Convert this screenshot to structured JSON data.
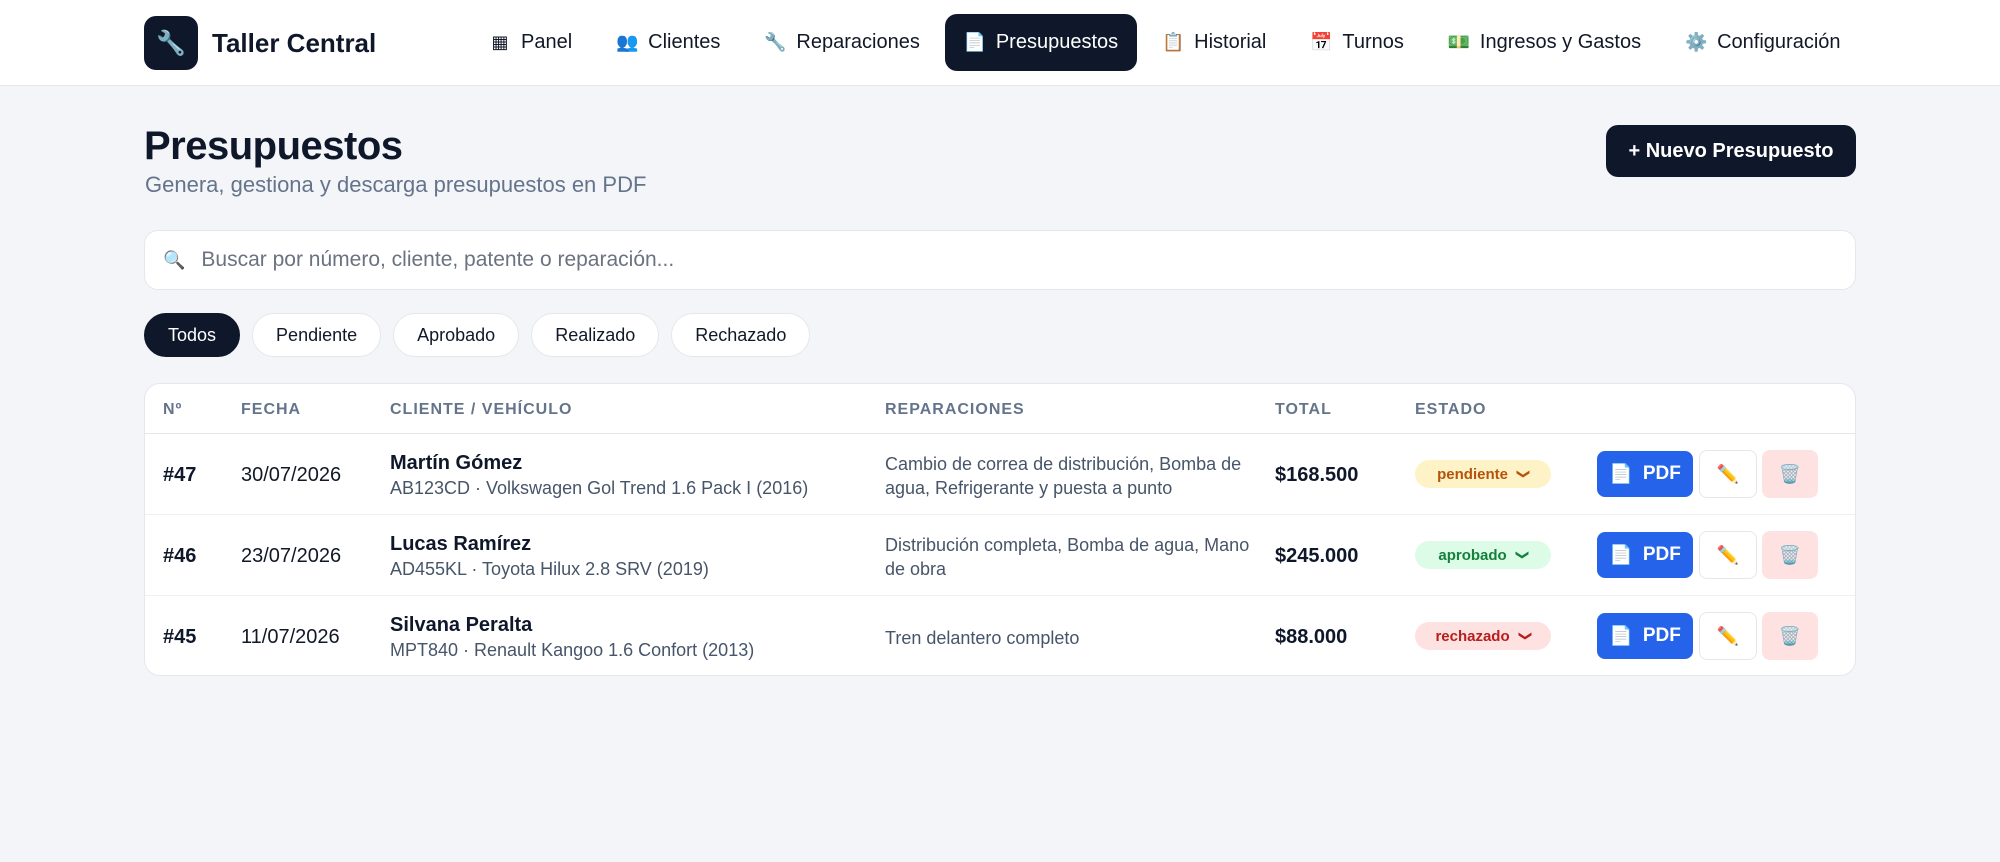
{
  "app": {
    "brand_name": "Taller Central",
    "brand_icon": "wrench-icon"
  },
  "nav": {
    "items": [
      {
        "icon": "▦",
        "icon_name": "dashboard-icon",
        "label": "Panel"
      },
      {
        "icon": "👥",
        "icon_name": "users-icon",
        "label": "Clientes"
      },
      {
        "icon": "🔧",
        "icon_name": "wrench-icon",
        "label": "Reparaciones"
      },
      {
        "icon": "📄",
        "icon_name": "document-icon",
        "label": "Presupuestos",
        "active": true
      },
      {
        "icon": "📋",
        "icon_name": "clipboard-icon",
        "label": "Historial"
      },
      {
        "icon": "📅",
        "icon_name": "calendar-icon",
        "label": "Turnos"
      },
      {
        "icon": "💵",
        "icon_name": "money-icon",
        "label": "Ingresos y Gastos"
      },
      {
        "icon": "⚙️",
        "icon_name": "gear-icon",
        "label": "Configuración"
      }
    ]
  },
  "header": {
    "title": "Presupuestos",
    "subtitle": "Genera, gestiona y descarga presupuestos en PDF",
    "new_button": "+ Nuevo Presupuesto"
  },
  "search": {
    "placeholder": "Buscar por número, cliente, patente o reparación..."
  },
  "filters": [
    "Todos",
    "Pendiente",
    "Aprobado",
    "Realizado",
    "Rechazado"
  ],
  "table": {
    "headers": {
      "num": "Nº",
      "date": "FECHA",
      "client": "CLIENTE / VEHÍCULO",
      "repairs": "REPARACIONES",
      "total": "TOTAL",
      "status": "ESTADO"
    },
    "pdf_label": "PDF",
    "rows": [
      {
        "num": "#47",
        "date": "30/07/2026",
        "client": "Martín Gómez",
        "vehicle": "AB123CD · Volkswagen Gol Trend 1.6 Pack I (2016)",
        "repairs": "Cambio de correa de distribución, Bomba de agua, Refrigerante y puesta a punto",
        "total": "$168.500",
        "status": "pendiente"
      },
      {
        "num": "#46",
        "date": "23/07/2026",
        "client": "Lucas Ramírez",
        "vehicle": "AD455KL · Toyota Hilux 2.8 SRV (2019)",
        "repairs": "Distribución completa, Bomba de agua, Mano de obra",
        "total": "$245.000",
        "status": "aprobado"
      },
      {
        "num": "#45",
        "date": "11/07/2026",
        "client": "Silvana Peralta",
        "vehicle": "MPT840 · Renault Kangoo 1.6 Confort (2013)",
        "repairs": "Tren delantero completo",
        "total": "$88.000",
        "status": "rechazado"
      }
    ]
  },
  "colors": {
    "primary_dark": "#0f172a",
    "pdf_blue": "#2563eb",
    "pending": "#b45309",
    "approved": "#15803d",
    "rejected": "#b91c1c"
  }
}
